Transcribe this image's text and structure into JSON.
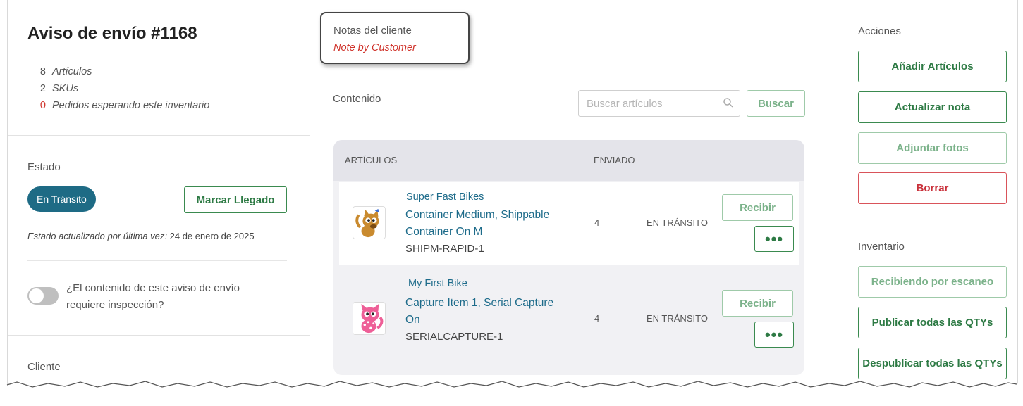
{
  "shipment": {
    "title": "Aviso de envío #1168",
    "stats": [
      {
        "value": "8",
        "label": "Artículos"
      },
      {
        "value": "2",
        "label": "SKUs"
      },
      {
        "value": "0",
        "label": "Pedidos esperando este inventario"
      }
    ]
  },
  "status": {
    "label": "Estado",
    "value": "En Tránsito",
    "mark_arrived_button": "Marcar Llegado",
    "updated_prefix": "Estado actualizado por última vez:",
    "updated_date": "24 de enero de 2025"
  },
  "inspection": {
    "question": "¿El contenido de este aviso de envío requiere inspección?",
    "enabled": false
  },
  "client": {
    "label": "Cliente"
  },
  "notes": {
    "title": "Notas del cliente",
    "text": "Note by Customer"
  },
  "contents": {
    "label": "Contenido",
    "search_placeholder": "Buscar artículos",
    "search_button": "Buscar",
    "columns": [
      "ARTÍCULOS",
      "ENVIADO"
    ],
    "items": [
      {
        "brand": "Super Fast Bikes",
        "name": "Container Medium, Shippable Container On M",
        "sku": "SHIPM-RAPID-1",
        "qty": "4",
        "status": "EN TRÁNSITO",
        "receive_button": "Recibir",
        "more_button": "•••"
      },
      {
        "brand": "My First Bike",
        "name": "Capture Item 1, Serial Capture On",
        "sku": "SERIALCAPTURE-1",
        "qty": "4",
        "status": "EN TRÁNSITO",
        "receive_button": "Recibir",
        "more_button": "•••"
      }
    ]
  },
  "actions": {
    "label": "Acciones",
    "add_items": "Añadir Artículos",
    "update_note": "Actualizar nota",
    "attach_photos": "Adjuntar fotos",
    "delete": "Borrar"
  },
  "inventory": {
    "label": "Inventario",
    "scan_receive": "Recibiendo por escaneo",
    "publish_all": "Publicar todas las QTYs",
    "unpublish_all": "Despublicar todas las QTYs"
  },
  "colors": {
    "primary_green": "#2d7a44",
    "link_blue": "#1d6b8a",
    "status_pill": "#1e6b85",
    "alert_red": "#d0342c"
  }
}
